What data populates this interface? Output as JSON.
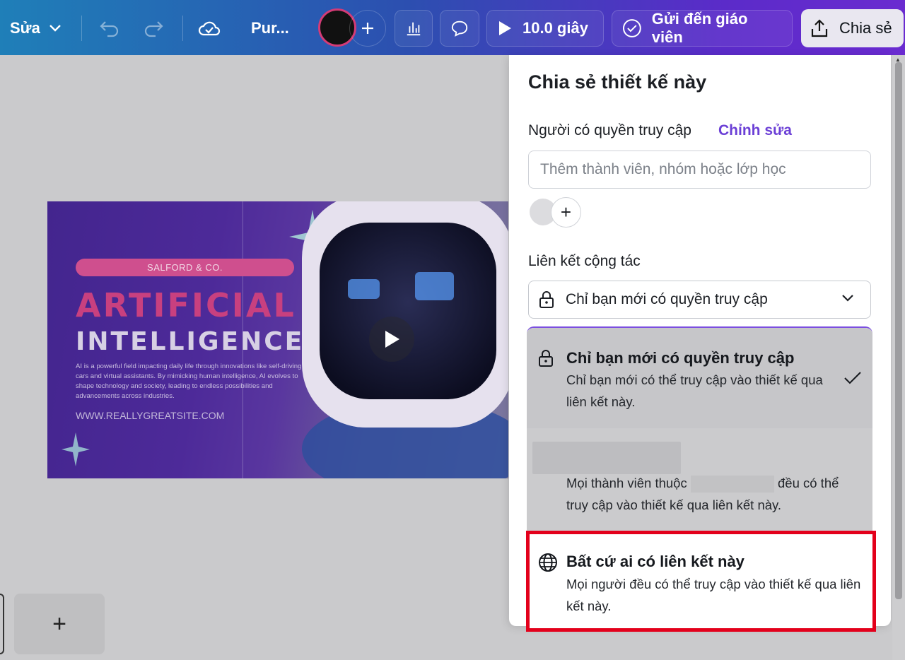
{
  "toolbar": {
    "edit_label": "Sửa",
    "doc_title": "Pur...",
    "duration_label": "10.0 giây",
    "send_teacher_label": "Gửi đến giáo viên",
    "share_label": "Chia sẻ",
    "color_swatch": "#111111"
  },
  "design": {
    "brand": "SALFORD & CO.",
    "headline_1": "ARTIFICIAL",
    "headline_2": "INTELLIGENCE",
    "description": "AI is a powerful field impacting daily life through innovations like self-driving cars and virtual assistants. By mimicking human intelligence, AI evolves to shape technology and society, leading to endless possibilities and advancements across industries.",
    "url": "WWW.REALLYGREATSITE.COM"
  },
  "pages": {
    "add_page_symbol": "+"
  },
  "share_panel": {
    "title": "Chia sẻ thiết kế này",
    "access_label": "Người có quyền truy cập",
    "edit_link": "Chỉnh sửa",
    "member_input_placeholder": "Thêm thành viên, nhóm hoặc lớp học",
    "add_member_symbol": "+",
    "collab_link_label": "Liên kết cộng tác",
    "selected_access": "Chỉ bạn mới có quyền truy cập",
    "options": [
      {
        "title": "Chỉ bạn mới có quyền truy cập",
        "description": "Chỉ bạn mới có thể truy cập vào thiết kế qua liên kết này.",
        "selected": true
      },
      {
        "title": "",
        "description_prefix": "Mọi thành viên thuộc",
        "description_suffix": "đều có thể",
        "description_line2": "truy cập vào thiết kế qua liên kết này.",
        "selected": false
      },
      {
        "title": "Bất cứ ai có liên kết này",
        "description": "Mọi người đều có thể truy cập vào thiết kế qua liên kết này.",
        "selected": false,
        "highlighted": true
      }
    ]
  },
  "colors": {
    "accent": "#6b3fd6",
    "highlight_border": "#e3001b",
    "brand_pink": "#c8407f"
  }
}
